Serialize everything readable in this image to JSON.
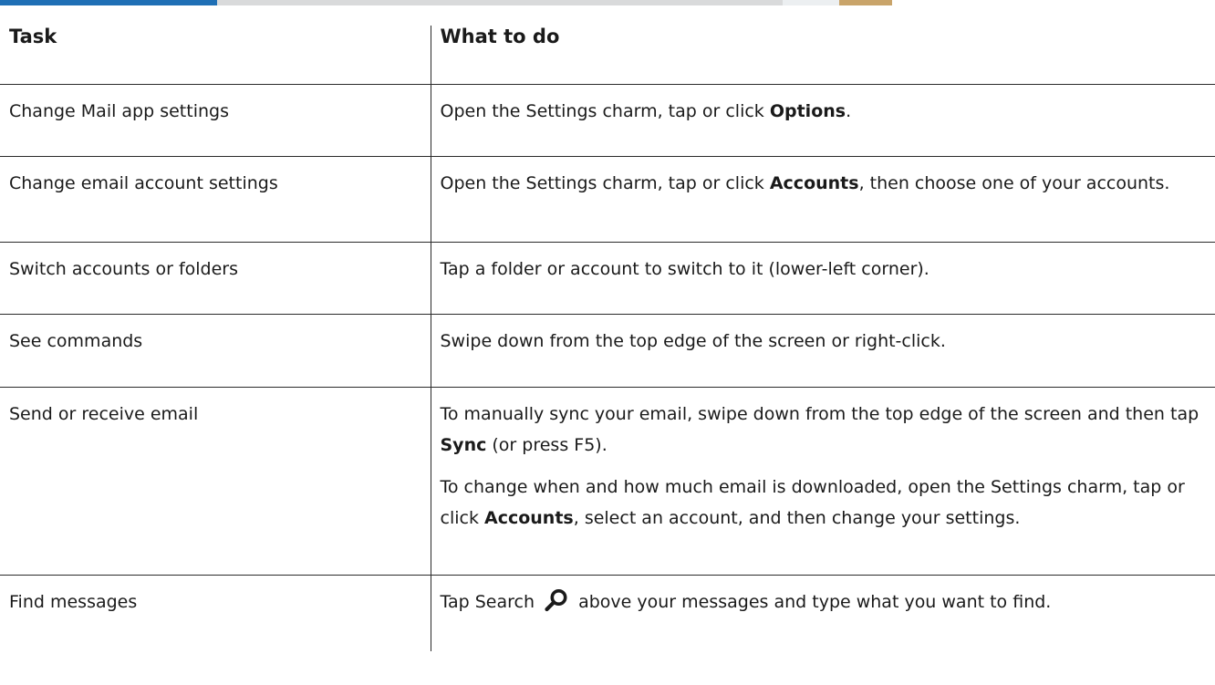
{
  "table": {
    "headers": [
      "Task",
      "What to do"
    ],
    "rows": [
      {
        "task": "Change Mail app settings",
        "what": [
          {
            "t": "Open the Settings charm, tap or click "
          },
          {
            "b": "Options"
          },
          {
            "t": "."
          }
        ]
      },
      {
        "task": "Change email account settings",
        "what": [
          {
            "t": "Open the Settings charm, tap or click "
          },
          {
            "b": "Accounts"
          },
          {
            "t": ", then choose one of your accounts."
          }
        ]
      },
      {
        "task": "Switch accounts or folders",
        "what": [
          {
            "t": "Tap a folder or account to switch to it (lower-left corner)."
          }
        ]
      },
      {
        "task": "See commands",
        "what": [
          {
            "t": "Swipe down from the top edge of the screen or right-click."
          }
        ]
      },
      {
        "task": "Send or receive email",
        "what": [
          {
            "t": "To manually sync your email, swipe down from the top edge of the screen and then tap "
          },
          {
            "b": "Sync"
          },
          {
            "t": " (or press F5)."
          }
        ],
        "what2": [
          {
            "t": "To change when and how much email is downloaded, open the Settings charm, tap or click "
          },
          {
            "b": "Accounts"
          },
          {
            "t": ", select an account, and then change your settings."
          }
        ]
      },
      {
        "task": "Find messages",
        "what": [
          {
            "t": "Tap Search "
          },
          {
            "icon": "search-icon"
          },
          {
            "t": " above your messages and type what you want to find."
          }
        ]
      }
    ]
  }
}
